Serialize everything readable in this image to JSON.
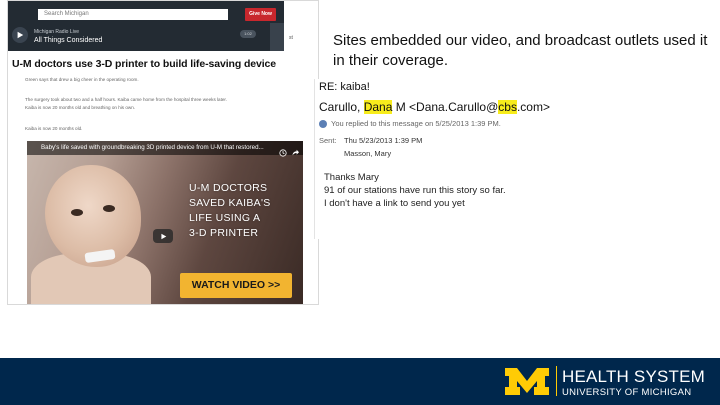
{
  "news_page": {
    "search_placeholder": "Search Michigan",
    "donate_label": "Give Now",
    "player": {
      "station": "Michigan Radio Live",
      "program": "All Things Considered",
      "time_badge": "1:02"
    },
    "side_text": "st",
    "headline": "U-M doctors use 3-D printer to build life-saving device",
    "body_lines": [
      "Green says that drew a big cheer in the operating room.",
      "The surgery took about two and a half hours. Kaiba came home from the hospital three weeks later.",
      "Kaiba is now 20 months old and breathing on his own."
    ],
    "byline": "Kaiba is now 20 months old.",
    "video": {
      "title": "Baby's life saved with groundbreaking 3D printed device from U-M that restored...",
      "overlay_lines": [
        "U-M DOCTORS",
        "SAVED KAIBA'S",
        "LIFE USING A",
        "3-D PRINTER"
      ],
      "button_label": "WATCH VIDEO >>"
    }
  },
  "caption": "Sites embedded our video, and broadcast outlets used it in their coverage.",
  "email": {
    "subject": "RE: kaiba!",
    "from_name_first": "Carullo, ",
    "from_name_hl": "Dana",
    "from_name_rest": " M <Dana.Carullo@",
    "from_domain_hl": "cbs",
    "from_domain_rest": ".com>",
    "replied_note": "You replied to this message on 5/25/2013 1:39 PM.",
    "sent_label": "Sent:",
    "sent_value": "Thu 5/23/2013 1:39 PM",
    "to_value": "Masson, Mary",
    "message_lines": [
      "Thanks Mary",
      "91 of our stations have run this story so far.",
      "I don't have a link to send you yet"
    ]
  },
  "footer": {
    "line1": "HEALTH SYSTEM",
    "line2": "UNIVERSITY OF MICHIGAN"
  },
  "colors": {
    "michigan_blue": "#00274c",
    "maize": "#ffcb05",
    "highlight": "#f7ec1c",
    "donate_red": "#c8272d",
    "watch_button": "#f2b430"
  }
}
